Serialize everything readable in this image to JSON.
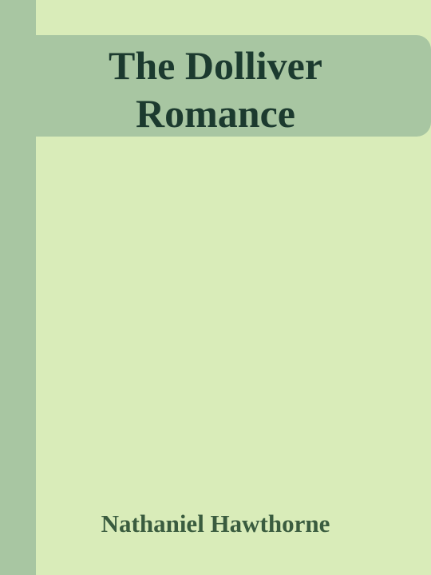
{
  "cover": {
    "title_line_1": "The Dolliver",
    "title_line_2": "Romance",
    "author": "Nathaniel Hawthorne"
  },
  "colors": {
    "background": "#d9ecb9",
    "band": "#a8c6a2",
    "title_text": "#1c3a2f",
    "author_text": "#3a5c3f"
  }
}
